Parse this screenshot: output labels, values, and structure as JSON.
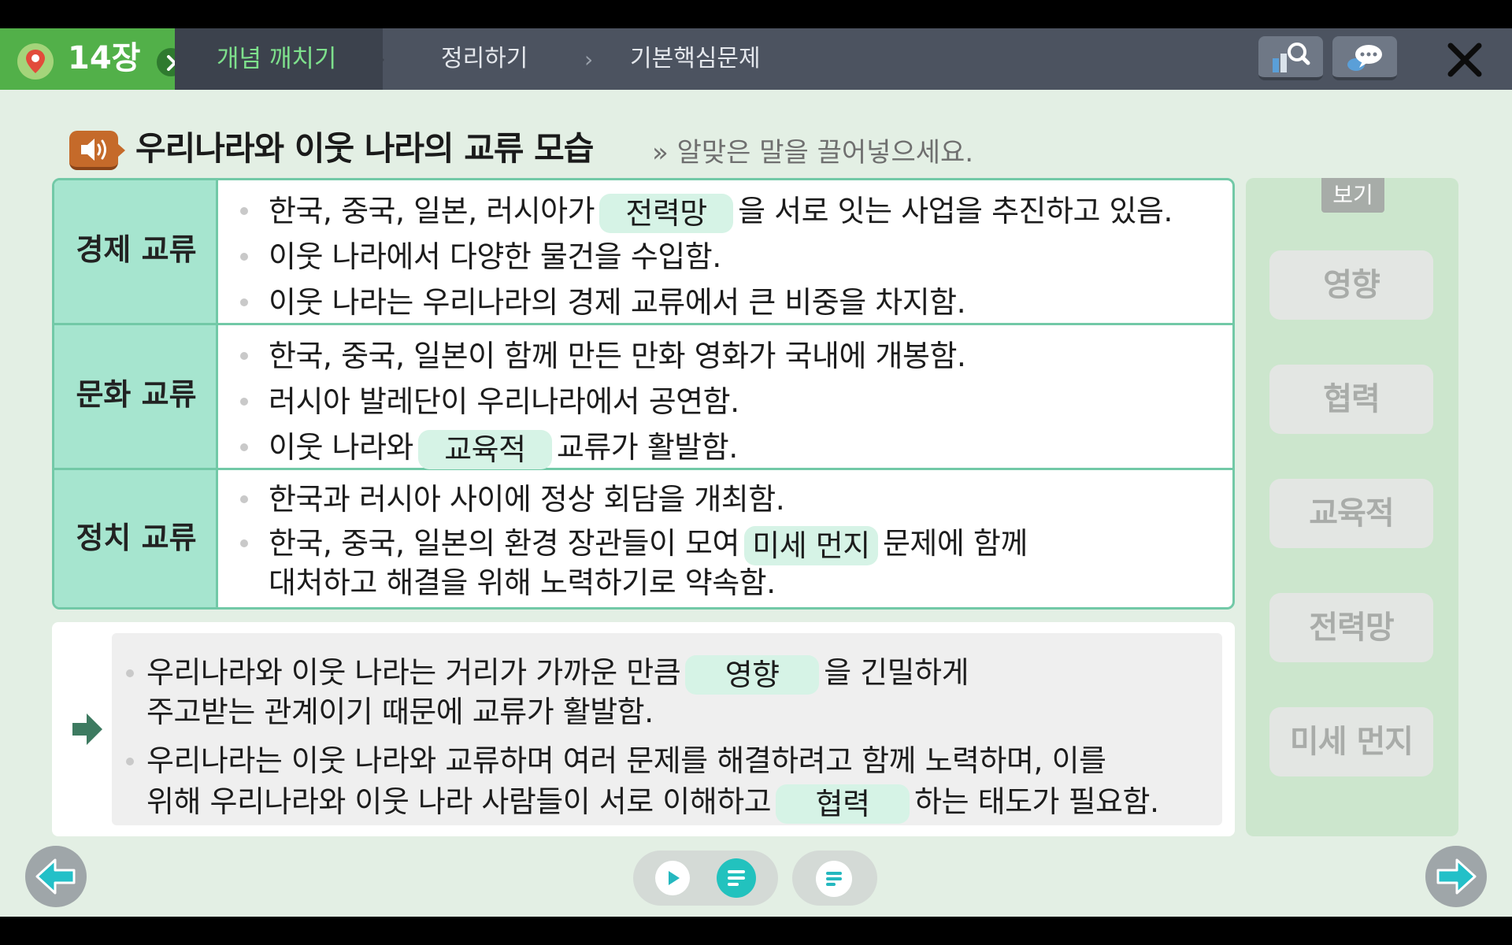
{
  "header": {
    "chapter": "14장",
    "tabs": [
      {
        "label": "개념 깨치기"
      },
      {
        "label": "정리하기"
      },
      {
        "label": "기본핵심문제"
      }
    ],
    "separator": "›"
  },
  "heading": {
    "title": "우리나라와 이웃 나라의 교류 모습",
    "instruction": "» 알맞은 말을 끌어넣으세요."
  },
  "table": {
    "rows": [
      {
        "category": "경제 교류",
        "lines": [
          {
            "before": "한국, 중국, 일본, 러시아가",
            "blank": "전력망",
            "after": "을 서로 잇는 사업을 추진하고 있음."
          },
          {
            "text": "이웃 나라에서 다양한 물건을 수입함."
          },
          {
            "text": "이웃 나라는 우리나라의 경제 교류에서 큰 비중을 차지함."
          }
        ]
      },
      {
        "category": "문화 교류",
        "lines": [
          {
            "text": "한국, 중국, 일본이 함께 만든 만화 영화가 국내에 개봉함."
          },
          {
            "text": "러시아 발레단이 우리나라에서 공연함."
          },
          {
            "before": "이웃 나라와",
            "blank": "교육적",
            "after": "교류가 활발함."
          }
        ]
      },
      {
        "category": "정치 교류",
        "lines": [
          {
            "text": "한국과 러시아 사이에 정상 회담을 개최함."
          },
          {
            "before": "한국, 중국, 일본의 환경 장관들이 모여",
            "blank": "미세 먼지",
            "after": "문제에 함께"
          },
          {
            "text": "대처하고 해결을 위해 노력하기로 약속함."
          }
        ]
      }
    ]
  },
  "summary": {
    "items": [
      {
        "line1_before": "우리나라와 이웃 나라는 거리가 가까운 만큼",
        "line1_blank": "영향",
        "line1_after": "을 긴밀하게",
        "line2": "주고받는 관계이기 때문에 교류가 활발함."
      },
      {
        "line1": "우리나라는 이웃 나라와 교류하며 여러 문제를 해결하려고 함께 노력하며, 이를",
        "line2_before": "위해 우리나라와 이웃 나라 사람들이 서로 이해하고",
        "line2_blank": "협력",
        "line2_after": "하는 태도가 필요함."
      }
    ]
  },
  "wordbank": {
    "label": "보기",
    "words": [
      "영향",
      "협력",
      "교육적",
      "전력망",
      "미세 먼지"
    ]
  },
  "colors": {
    "accent_green": "#52b049",
    "table_border": "#72c9a7",
    "category_bg": "#a6e5cf",
    "blank_bg": "#d6f3e6",
    "speaker": "#c56a2a",
    "nav_active": "#22c2be"
  },
  "icons": {
    "chapter": "map-pin-icon",
    "search": "search-icon",
    "chat": "chat-icon",
    "close": "close-icon",
    "speaker": "speaker-icon",
    "prev": "arrow-left-icon",
    "next": "arrow-right-icon",
    "play": "play-icon",
    "list": "list-icon"
  }
}
